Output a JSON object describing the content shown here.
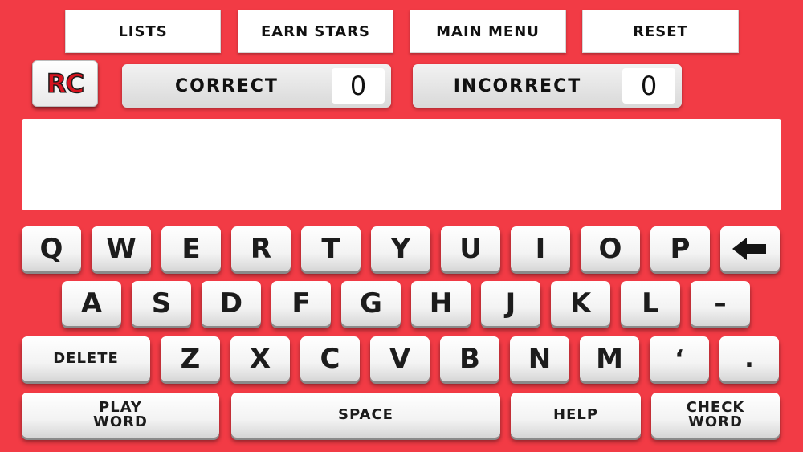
{
  "nav": {
    "lists": "LISTS",
    "earn_stars": "EARN STARS",
    "main_menu": "MAIN MENU",
    "reset": "RESET"
  },
  "logo": {
    "text": "RC"
  },
  "scores": {
    "correct_label": "CORRECT",
    "correct_value": "0",
    "incorrect_label": "INCORRECT",
    "incorrect_value": "0"
  },
  "word_display": {
    "text": ""
  },
  "keyboard": {
    "row1": [
      "Q",
      "W",
      "E",
      "R",
      "T",
      "Y",
      "U",
      "I",
      "O",
      "P"
    ],
    "backspace_icon": "left-arrow-icon",
    "row2": [
      "A",
      "S",
      "D",
      "F",
      "G",
      "H",
      "J",
      "K",
      "L",
      "–"
    ],
    "delete": "DELETE",
    "row3": [
      "Z",
      "X",
      "C",
      "V",
      "B",
      "N",
      "M",
      "‘",
      "."
    ],
    "play_word_line1": "PLAY",
    "play_word_line2": "WORD",
    "space": "SPACE",
    "help": "HELP",
    "check_word_line1": "CHECK",
    "check_word_line2": "WORD"
  },
  "colors": {
    "background": "#f23b45",
    "logo_red": "#d7141f"
  }
}
